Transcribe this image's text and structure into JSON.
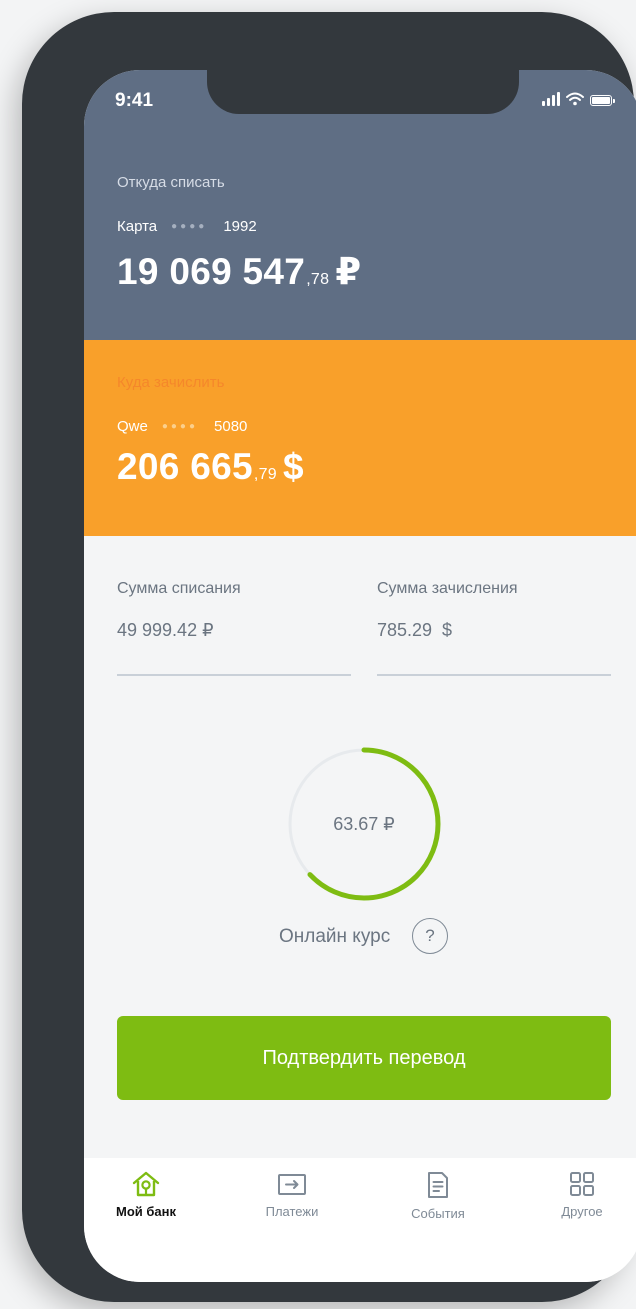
{
  "status": {
    "time": "9:41"
  },
  "source": {
    "label": "Откуда списать",
    "account_name": "Карта",
    "masked_digits": "●●●●",
    "last_digits": "1992",
    "amount_whole": "19 069 547",
    "amount_cents": ",78",
    "currency": "₽"
  },
  "destination": {
    "label": "Куда зачислить",
    "account_name": "Qwe",
    "masked_digits": "●●●●",
    "last_digits": "5080",
    "amount_whole": "206 665",
    "amount_cents": ",79",
    "currency": "$"
  },
  "transfer": {
    "debit_label": "Сумма списания",
    "debit_value": "49 999.42 ₽",
    "credit_label": "Сумма зачисления",
    "credit_value": "785.29  $"
  },
  "rate": {
    "value": "63.67 ₽",
    "label": "Онлайн курс",
    "help": "?",
    "progress": 0.63
  },
  "confirm_button": "Подтвердить перевод",
  "tabs": [
    {
      "label": "Мой банк",
      "icon": "home-icon",
      "active": true
    },
    {
      "label": "Платежи",
      "icon": "payments-icon",
      "active": false
    },
    {
      "label": "События",
      "icon": "document-icon",
      "active": false
    },
    {
      "label": "Другое",
      "icon": "grid-icon",
      "active": false
    }
  ],
  "colors": {
    "source_bg": "#5f6e84",
    "destination_bg": "#f9a02a",
    "accent_green": "#7ebc12"
  }
}
